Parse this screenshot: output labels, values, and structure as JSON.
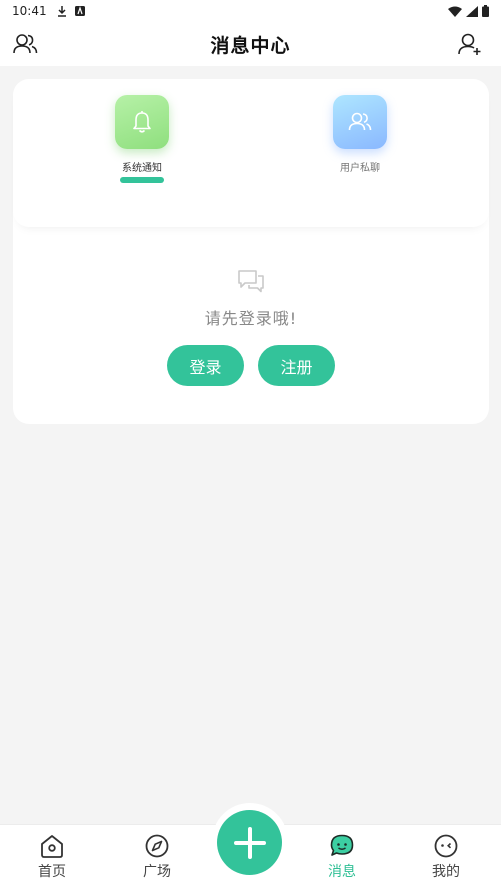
{
  "status_bar": {
    "time": "10:41"
  },
  "header": {
    "title": "消息中心"
  },
  "tabs": [
    {
      "label": "系统通知",
      "icon": "bell-icon",
      "active": true
    },
    {
      "label": "用户私聊",
      "icon": "users-icon",
      "active": false
    }
  ],
  "empty_state": {
    "icon": "chat-bubbles-icon",
    "text": "请先登录哦!"
  },
  "buttons": {
    "login": "登录",
    "register": "注册"
  },
  "bottom_nav": {
    "items": [
      {
        "label": "首页",
        "icon": "home-icon",
        "active": false
      },
      {
        "label": "广场",
        "icon": "compass-icon",
        "active": false
      },
      {
        "label": "消息",
        "icon": "message-icon",
        "active": true
      },
      {
        "label": "我的",
        "icon": "profile-icon",
        "active": false
      }
    ],
    "fab": "plus-icon"
  },
  "colors": {
    "accent": "#33c39a",
    "active_nav": "#2fbf95",
    "background": "#f4f4f4"
  }
}
